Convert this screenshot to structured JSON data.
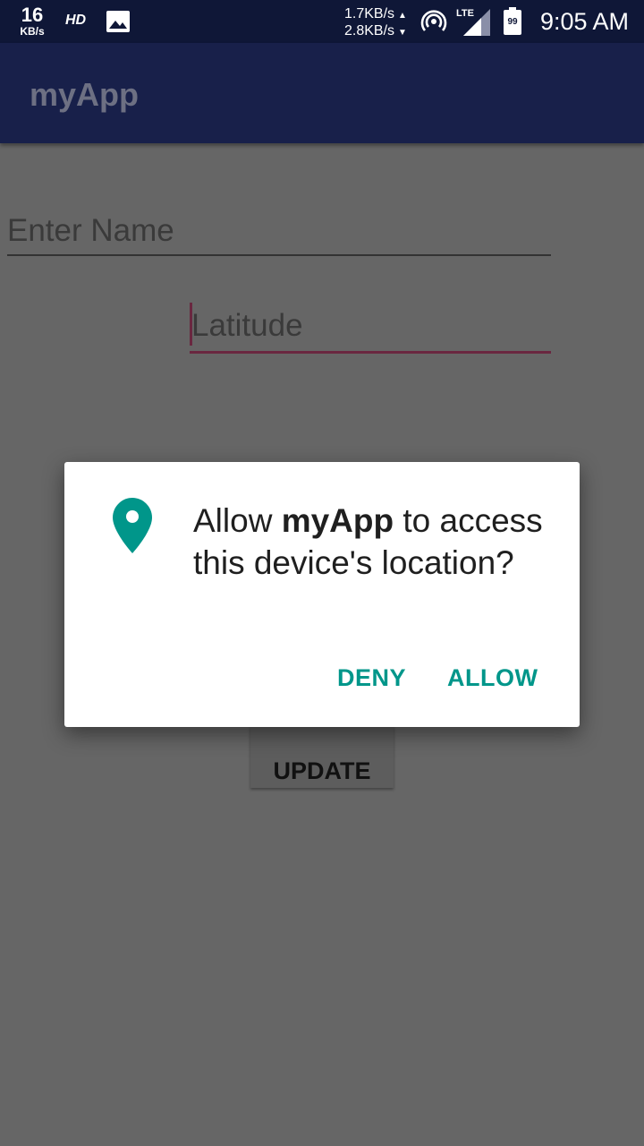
{
  "status_bar": {
    "speed_value": "16",
    "speed_unit": "KB/s",
    "hd": "HD",
    "upload_rate": "1.7KB/s",
    "download_rate": "2.8KB/s",
    "lte": "LTE",
    "battery": "99",
    "time": "9:05 AM"
  },
  "app_bar": {
    "title": "myApp"
  },
  "form": {
    "name_placeholder": "Enter Name",
    "latitude_placeholder": "Latitude",
    "update_label": "UPDATE"
  },
  "dialog": {
    "message_pre": "Allow ",
    "app_name": "myApp",
    "message_post": " to access this device's location?",
    "deny_label": "DENY",
    "allow_label": "ALLOW",
    "icon": "location-pin-icon"
  },
  "colors": {
    "status_bar": "#0f1737",
    "app_bar": "#18204a",
    "accent": "#00968a",
    "focus_underline": "#6a2740",
    "scrim_background": "#666666"
  }
}
